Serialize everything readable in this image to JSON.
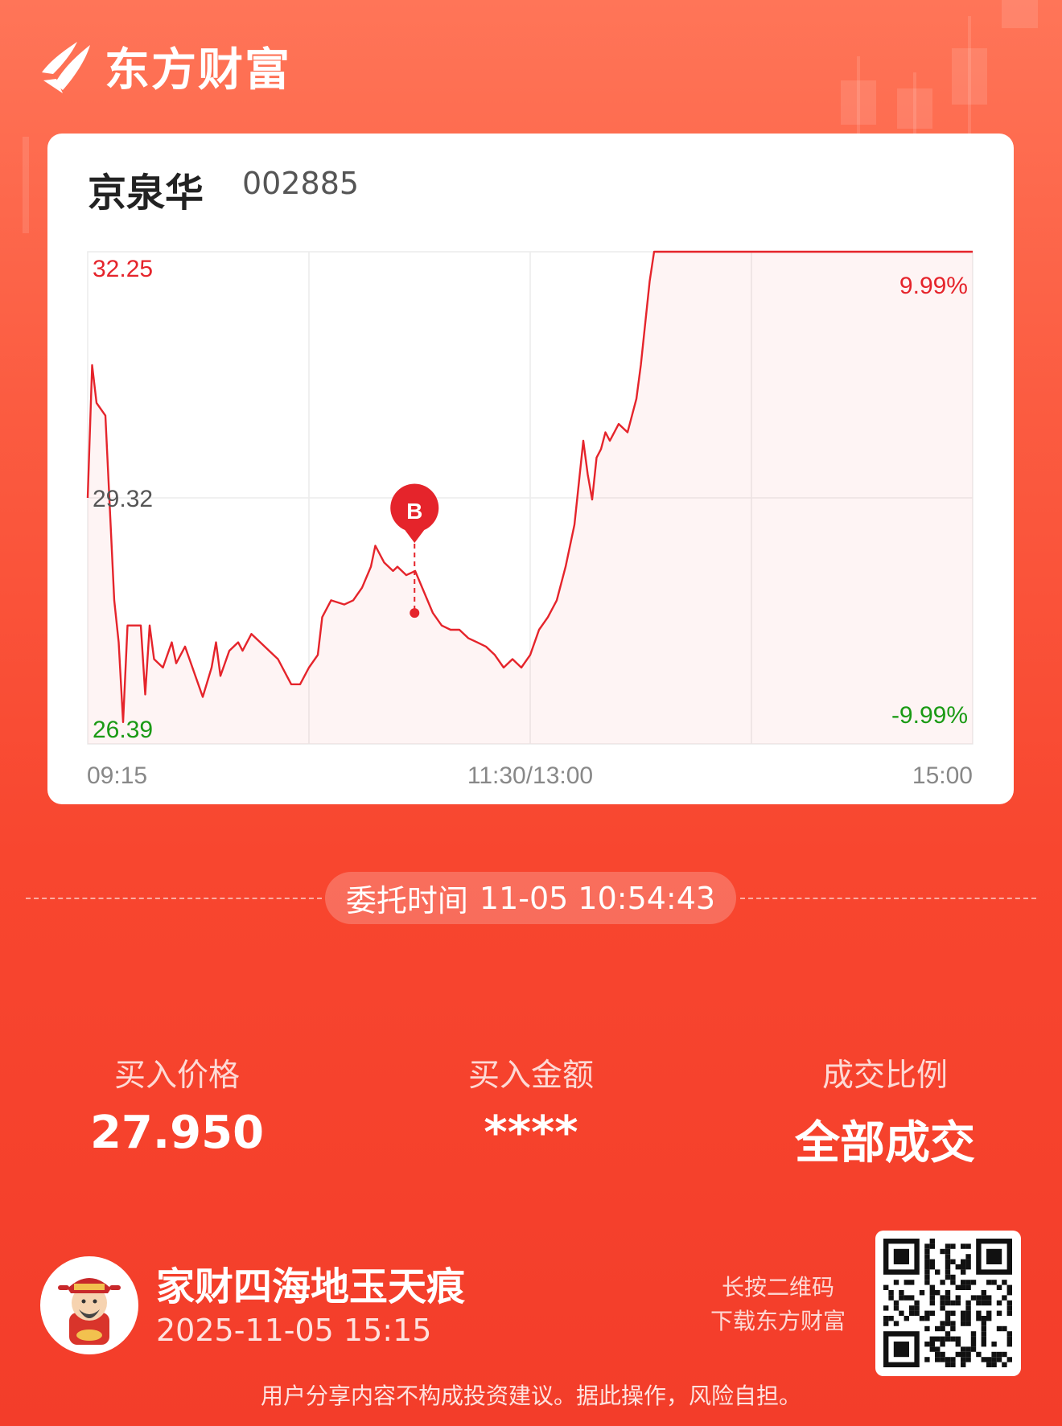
{
  "brand": {
    "name": "东方财富",
    "color": "#f44a30"
  },
  "stock": {
    "name": "京泉华",
    "code": "002885"
  },
  "chart_data": {
    "type": "line",
    "title": "",
    "price_max": 32.25,
    "price_ref": 29.32,
    "price_min": 26.39,
    "pct_max": "9.99%",
    "pct_min": "-9.99%",
    "labels": {
      "top": "32.25",
      "mid": "29.32",
      "bottom": "26.39",
      "pct_top": "9.99%",
      "pct_bottom": "-9.99%"
    },
    "x_ticks": [
      "09:15",
      "11:30/13:00",
      "15:00"
    ],
    "buy_marker": {
      "label": "B",
      "time": "10:54:43",
      "price": 27.95
    },
    "series": [
      {
        "color": "#e5242b",
        "points": [
          [
            0,
            29.32
          ],
          [
            0.005,
            30.9
          ],
          [
            0.01,
            30.45
          ],
          [
            0.02,
            30.3
          ],
          [
            0.03,
            28.1
          ],
          [
            0.035,
            27.6
          ],
          [
            0.04,
            26.65
          ],
          [
            0.045,
            27.8
          ],
          [
            0.055,
            27.8
          ],
          [
            0.06,
            27.8
          ],
          [
            0.065,
            26.98
          ],
          [
            0.07,
            27.8
          ],
          [
            0.075,
            27.4
          ],
          [
            0.085,
            27.3
          ],
          [
            0.095,
            27.6
          ],
          [
            0.1,
            27.35
          ],
          [
            0.11,
            27.55
          ],
          [
            0.115,
            27.4
          ],
          [
            0.125,
            27.1
          ],
          [
            0.13,
            26.95
          ],
          [
            0.14,
            27.3
          ],
          [
            0.145,
            27.6
          ],
          [
            0.15,
            27.2
          ],
          [
            0.16,
            27.5
          ],
          [
            0.17,
            27.6
          ],
          [
            0.175,
            27.5
          ],
          [
            0.185,
            27.7
          ],
          [
            0.195,
            27.6
          ],
          [
            0.205,
            27.5
          ],
          [
            0.215,
            27.4
          ],
          [
            0.225,
            27.2
          ],
          [
            0.23,
            27.1
          ],
          [
            0.24,
            27.1
          ],
          [
            0.25,
            27.3
          ],
          [
            0.26,
            27.45
          ],
          [
            0.265,
            27.9
          ],
          [
            0.275,
            28.1
          ],
          [
            0.29,
            28.05
          ],
          [
            0.3,
            28.1
          ],
          [
            0.31,
            28.25
          ],
          [
            0.32,
            28.5
          ],
          [
            0.325,
            28.75
          ],
          [
            0.335,
            28.55
          ],
          [
            0.345,
            28.45
          ],
          [
            0.35,
            28.5
          ],
          [
            0.36,
            28.4
          ],
          [
            0.37,
            28.45
          ],
          [
            0.38,
            28.2
          ],
          [
            0.39,
            27.95
          ],
          [
            0.4,
            27.8
          ],
          [
            0.41,
            27.75
          ],
          [
            0.42,
            27.75
          ],
          [
            0.43,
            27.65
          ],
          [
            0.44,
            27.6
          ],
          [
            0.45,
            27.55
          ],
          [
            0.46,
            27.45
          ],
          [
            0.47,
            27.3
          ],
          [
            0.48,
            27.4
          ],
          [
            0.49,
            27.3
          ],
          [
            0.5,
            27.45
          ],
          [
            0.51,
            27.75
          ],
          [
            0.52,
            27.9
          ],
          [
            0.53,
            28.1
          ],
          [
            0.54,
            28.5
          ],
          [
            0.55,
            29.0
          ],
          [
            0.555,
            29.5
          ],
          [
            0.56,
            30.0
          ],
          [
            0.565,
            29.6
          ],
          [
            0.57,
            29.3
          ],
          [
            0.575,
            29.8
          ],
          [
            0.58,
            29.9
          ],
          [
            0.585,
            30.1
          ],
          [
            0.59,
            30.0
          ],
          [
            0.6,
            30.2
          ],
          [
            0.61,
            30.1
          ],
          [
            0.615,
            30.3
          ],
          [
            0.62,
            30.5
          ],
          [
            0.625,
            30.9
          ],
          [
            0.63,
            31.4
          ],
          [
            0.635,
            31.9
          ],
          [
            0.64,
            32.25
          ],
          [
            0.7,
            32.25
          ],
          [
            0.8,
            32.25
          ],
          [
            0.9,
            32.25
          ],
          [
            1.0,
            32.25
          ]
        ]
      }
    ]
  },
  "order": {
    "label": "委托时间",
    "datetime": "11-05 10:54:43"
  },
  "stats": {
    "price": {
      "label": "买入价格",
      "value": "27.950"
    },
    "amount": {
      "label": "买入金额",
      "value": "****"
    },
    "ratio": {
      "label": "成交比例",
      "value": "全部成交"
    }
  },
  "user": {
    "name": "家财四海地玉天痕",
    "time": "2025-11-05 15:15"
  },
  "qr_hint": {
    "line1": "长按二维码",
    "line2": "下载东方财富"
  },
  "disclaimer": "用户分享内容不构成投资建议。据此操作，风险自担。",
  "colors": {
    "up": "#e5242b",
    "down": "#1a9a14",
    "grid": "#ededed"
  }
}
